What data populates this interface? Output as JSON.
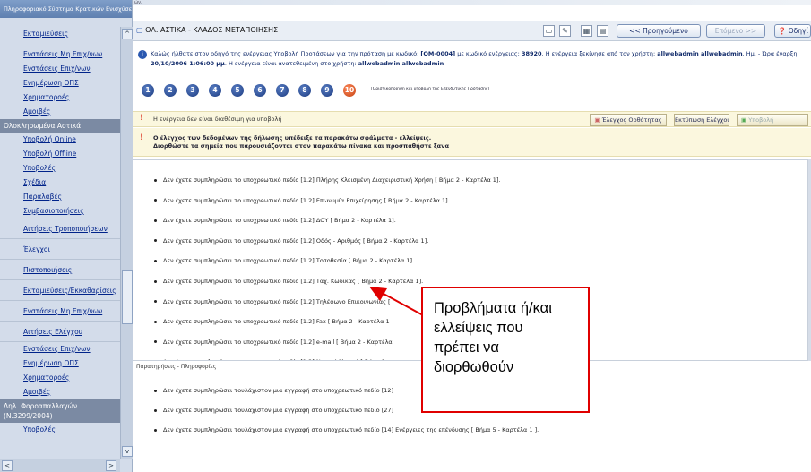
{
  "sidebar": {
    "title": "Πληροφοριακό Σύστημα Κρατικών Ενισχύσε",
    "items": [
      {
        "kind": "link",
        "label": "Εκταμιεύσεις"
      },
      {
        "kind": "gap",
        "label": ""
      },
      {
        "kind": "link",
        "label": "Ενστάσεις Μη Επιχ/νων"
      },
      {
        "kind": "link",
        "label": "Ενστάσεις Επιχ/νων"
      },
      {
        "kind": "link",
        "label": "Ενημέρωση ΟΠΣ"
      },
      {
        "kind": "link",
        "label": "Χρηματοροές"
      },
      {
        "kind": "link",
        "label": "Αμοιβές"
      },
      {
        "kind": "cat",
        "label": "Ολοκληρωμένα Αστικά"
      },
      {
        "kind": "link",
        "label": "Υποβολή Online"
      },
      {
        "kind": "link",
        "label": "Υποβολή Offline"
      },
      {
        "kind": "link",
        "label": "Υποβολές"
      },
      {
        "kind": "link",
        "label": "Σχέδια"
      },
      {
        "kind": "link",
        "label": "Παραλαβές"
      },
      {
        "kind": "link",
        "label": "Συμβασιοποιήσεις"
      },
      {
        "kind": "gaplink",
        "label": "Αιτήσεις Τροποποιήσεων"
      },
      {
        "kind": "gaplink",
        "label": "Έλεγχοι"
      },
      {
        "kind": "gaplink",
        "label": "Πιστοποιήσεις"
      },
      {
        "kind": "gaplink",
        "label": "Εκταμιεύσεις/Εκκαθαρίσεις"
      },
      {
        "kind": "gaplink",
        "label": "Ενστάσεις Μη Επιχ/νων"
      },
      {
        "kind": "gaplink",
        "label": "Αιτήσεις Ελέγχου"
      },
      {
        "kind": "link",
        "label": "Ενστάσεις Επιχ/νων"
      },
      {
        "kind": "link",
        "label": "Ενημέρωση ΟΠΣ"
      },
      {
        "kind": "link",
        "label": "Χρηματοροές"
      },
      {
        "kind": "link",
        "label": "Αμοιβές"
      },
      {
        "kind": "cattall",
        "label": "Δηλ. Φοροαπαλλαγών (Ν.3299/2004)"
      },
      {
        "kind": "link",
        "label": "Υποβολές"
      }
    ]
  },
  "topstrip": "ών.",
  "toolbar": {
    "title": "ΟΛ. ΑΣΤΙΚΑ - ΚΛΑΔΟΣ ΜΕΤΑΠΟΙΗΣΗΣ",
    "prev_label": "<< Προηγούμενο",
    "next_label": "Επόμενο >>",
    "guide_label": "Οδηγί"
  },
  "info": {
    "line1_pre": "Καλώς ήλθατε στον οδηγό της ενέργειας Υποβολή Προτάσεων για την πρόταση με κωδικό: ",
    "code": "[ΟΜ-0004]",
    "line1_mid": " με κωδικό ενέργειας: ",
    "action_code": "38920",
    "line1_post": ". Η ενέργεια ξεκίνησε από τον χρήστη: ",
    "user": "allwebadmin allwebadmin",
    "line1_end": ". Ημ. - Ώρα έναρξη",
    "date": "20/10/2006 1:06:00 μμ",
    "line2_mid": ". Η ενέργεια είναι ανατεθειμένη στο χρήστη: ",
    "assignee": "allwebadmin allwebadmin"
  },
  "steps": {
    "numbers": [
      "1",
      "2",
      "3",
      "4",
      "5",
      "6",
      "7",
      "8",
      "9",
      "10"
    ],
    "active_label": "[Οριστικοποίηση και υποβολή της Επενδυτικής Πρότασης]"
  },
  "status": {
    "text": "Η ενέργεια δεν είναι διαθέσιμη για υποβολή",
    "check_btn": "Έλεγχος Ορθότητας",
    "print_btn": "Εκτύπωση Ελέγχου",
    "submit_btn": "Υποβολή"
  },
  "errors_header": {
    "line1": "Ο έλεγχος των δεδομένων της δήλωσης υπέδειξε τα παρακάτω σφάλματα - ελλείψεις.",
    "line2": "Διορθώστε τα σημεία που παρουσιάζονται στον παρακάτω πίνακα και προσπαθήστε ξανα"
  },
  "errors": [
    "Δεν έχετε συμπληρώσει το υποχρεωτικό πεδίο [1.2] Πλήρης Κλεισμένη Διαχειριστική Χρήση [ Βήμα 2 - Καρτέλα 1].",
    "Δεν έχετε συμπληρώσει το υποχρεωτικό πεδίο [1.2] Επωνυμία Επιχείρησης [ Βήμα 2 - Καρτέλα 1].",
    "Δεν έχετε συμπληρώσει το υποχρεωτικό πεδίο [1.2] ΔΟΥ [ Βήμα 2 - Καρτέλα 1].",
    "Δεν έχετε συμπληρώσει το υποχρεωτικό πεδίο [1.2] Οδός - Αριθμός [ Βήμα 2 - Καρτέλα 1].",
    "Δεν έχετε συμπληρώσει το υποχρεωτικό πεδίο [1.2] Τοποθεσία [ Βήμα 2 - Καρτέλα 1].",
    "Δεν έχετε συμπληρώσει το υποχρεωτικό πεδίο [1.2] Ταχ. Κώδικας [ Βήμα 2 - Καρτέλα 1].",
    "Δεν έχετε συμπληρώσει το υποχρεωτικό πεδίο [1.2] Τηλέφωνο Επικοινωνίας [",
    "Δεν έχετε συμπληρώσει το υποχρεωτικό πεδίο [1.2] Fax [ Βήμα 2 - Καρτέλα 1",
    "Δεν έχετε συμπληρώσει το υποχρεωτικό πεδίο [1.2] e-mail [ Βήμα 2 - Καρτέλα",
    "Δεν έχετε συμπληρώσει το υποχρεωτικό πεδίο [1.2] Νομική Μορφή [ Βήμα 2 -"
  ],
  "notes_title": "Παρατηρήσεις - Πληροφορίες",
  "notes": [
    "Δεν έχετε συμπληρώσει τουλάχιστον μια εγγραφή στο υποχρεωτικό πεδίο [12]",
    "Δεν έχετε συμπληρώσει τουλάχιστον μια εγγραφή στο υποχρεωτικό πεδίο [27]",
    "Δεν έχετε συμπληρώσει τουλάχιστον μια εγγραφή στο υποχρεωτικό πεδίο [14] Ενέργειες της επένδυσης [ Βήμα 5 - Καρτέλα 1 ]."
  ],
  "callout": {
    "lines": [
      "Προβλήματα ή/και",
      "ελλείψεις που",
      "πρέπει να",
      "διορθωθούν"
    ],
    "border_color": "#e00000"
  },
  "icons": {
    "prev": "chevron-left-double",
    "next": "chevron-right-double",
    "help": "help-icon",
    "warning": "exclamation-icon",
    "info": "info-icon"
  }
}
